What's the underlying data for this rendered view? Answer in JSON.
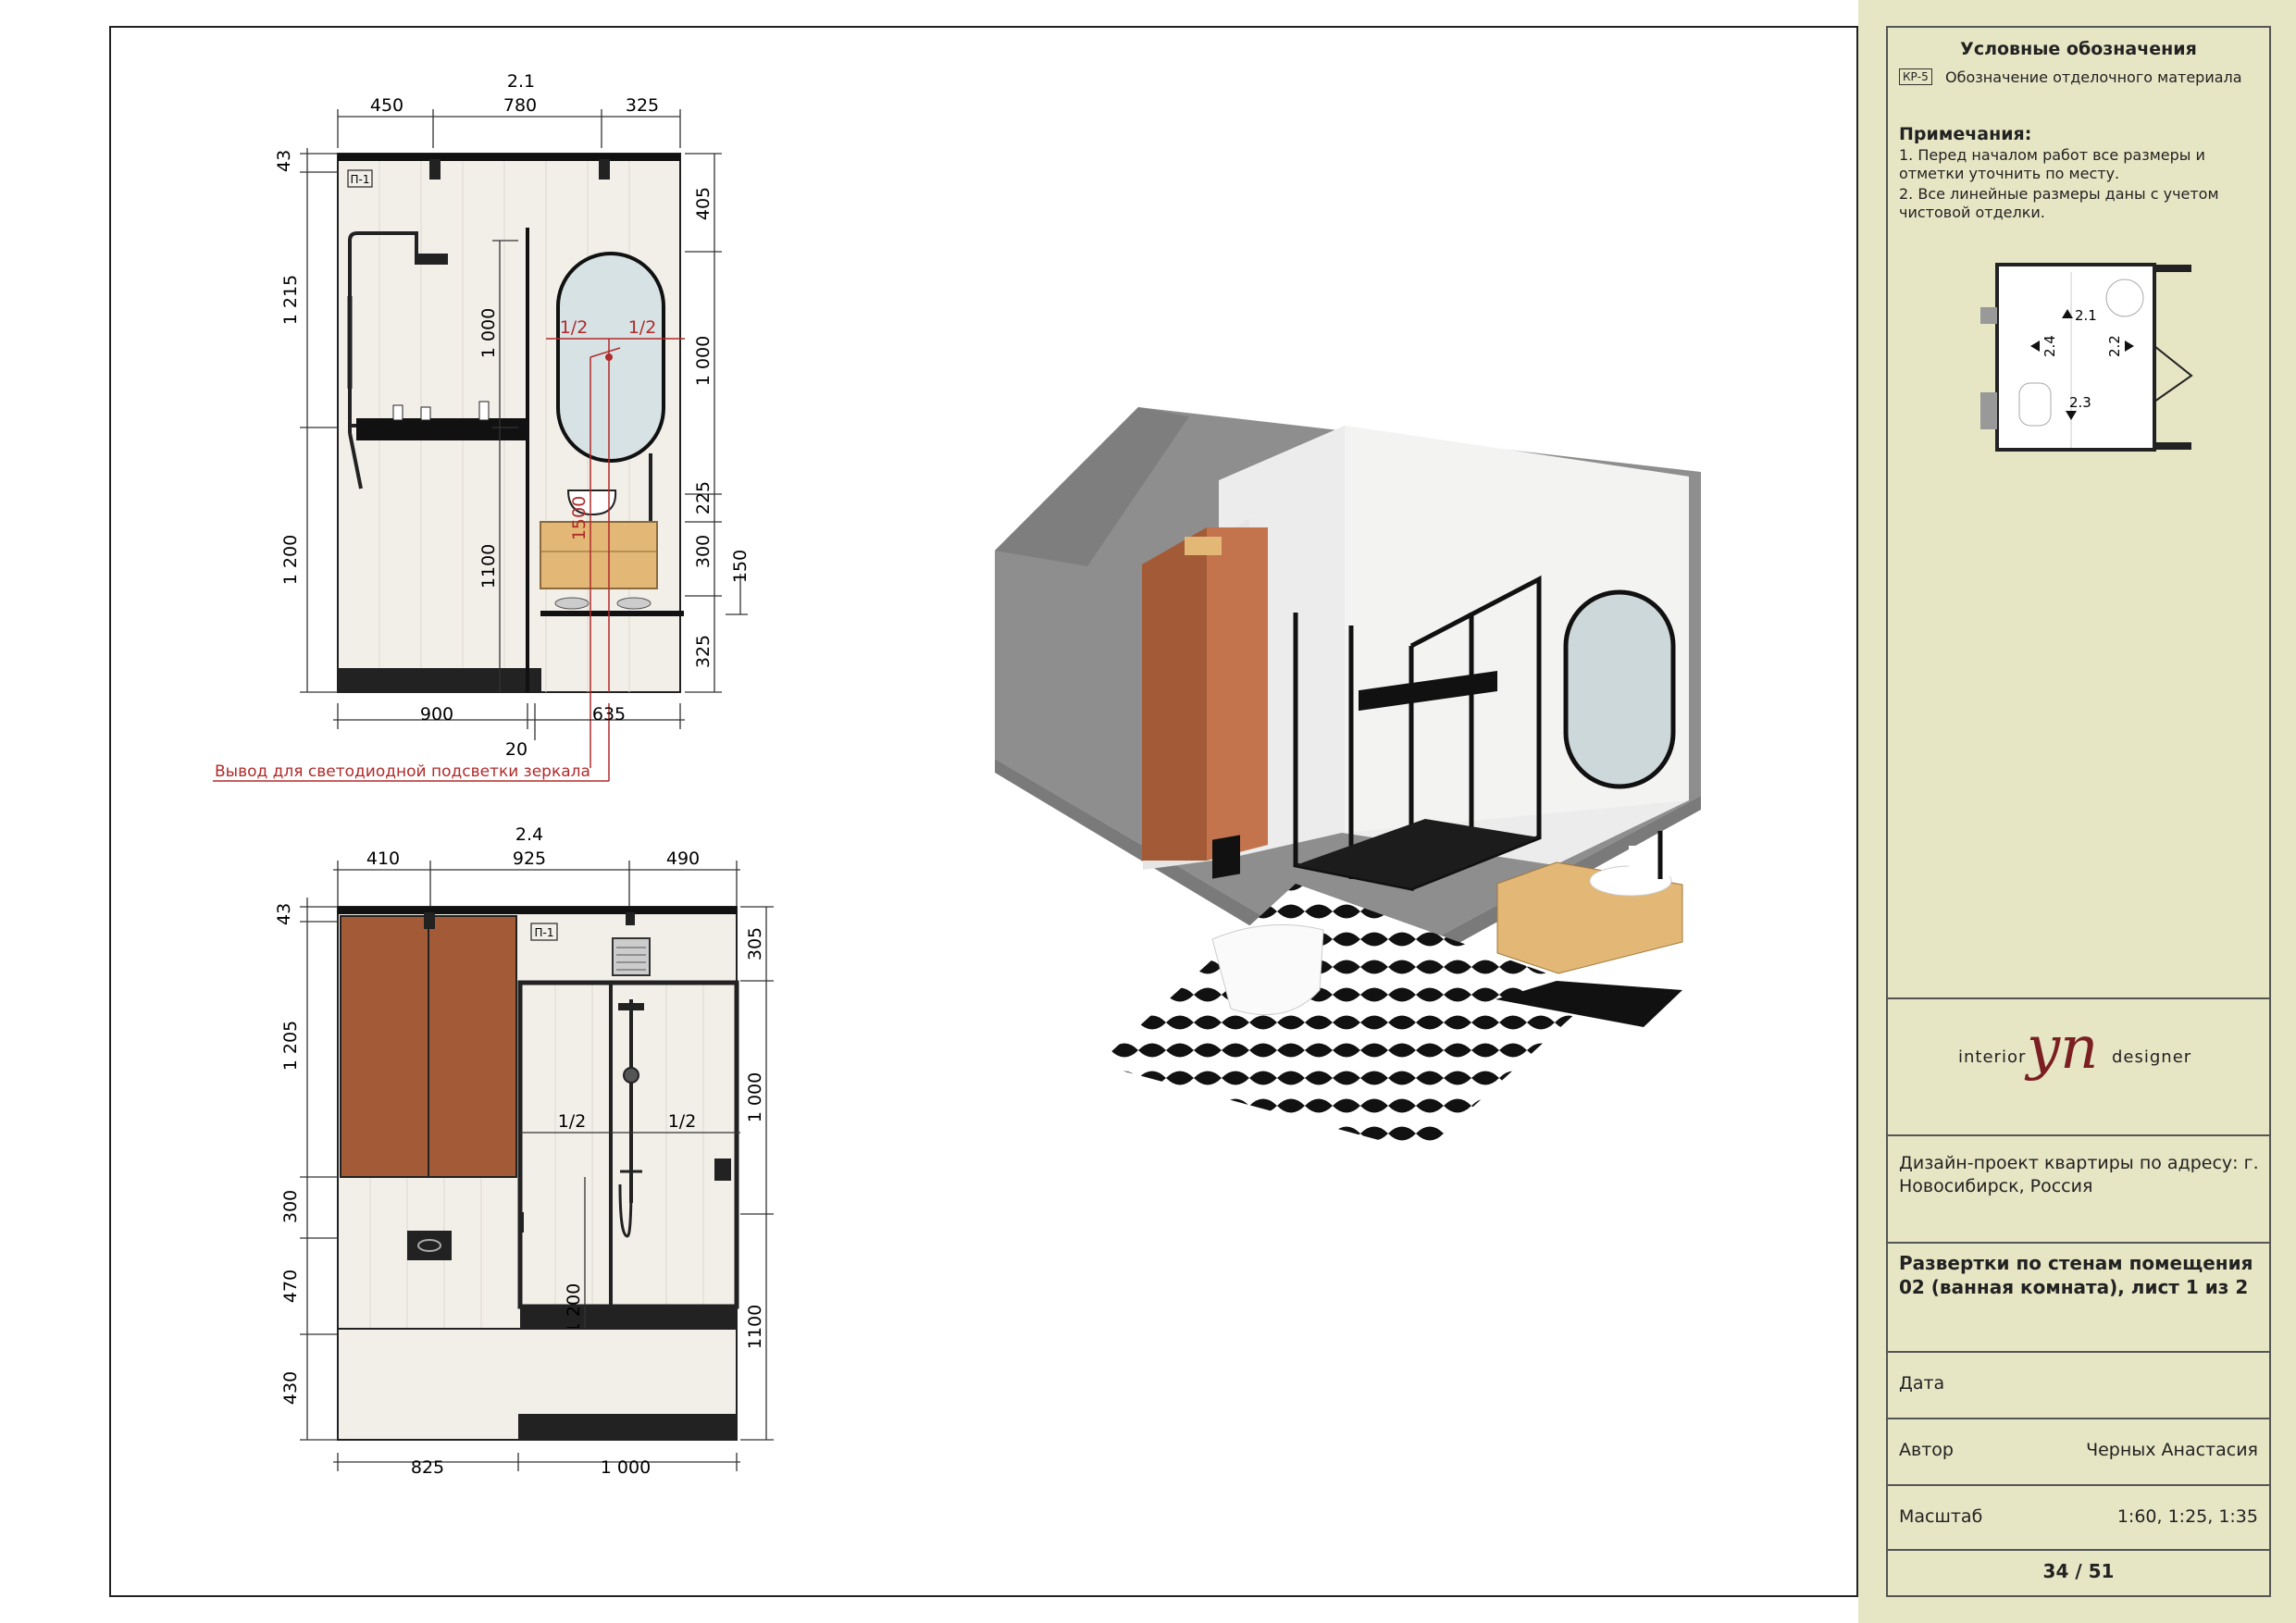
{
  "elevation_21": {
    "title": "2.1",
    "top_dims": [
      "450",
      "780",
      "325"
    ],
    "left_dims": [
      "43",
      "1 215",
      "1 200"
    ],
    "inner_dims": [
      "1 000",
      "1100",
      "1500"
    ],
    "right_dims": [
      "405",
      "1 000",
      "225",
      "300",
      "325",
      "150"
    ],
    "bottom_dims": [
      "900",
      "635",
      "20"
    ],
    "halves": [
      "1/2",
      "1/2"
    ],
    "material_tag": "П-1",
    "led_note": "Вывод для светодиодной подсветки зеркала"
  },
  "elevation_24": {
    "title": "2.4",
    "top_dims": [
      "410",
      "925",
      "490"
    ],
    "left_dims": [
      "43",
      "1 205",
      "300",
      "470",
      "430"
    ],
    "inner_dims": [
      "1 200"
    ],
    "right_dims": [
      "305",
      "1 000",
      "1100"
    ],
    "bottom_dims": [
      "825",
      "1 000"
    ],
    "halves": [
      "1/2",
      "1/2"
    ],
    "material_tag": "П-1"
  },
  "legend": {
    "title": "Условные обозначения",
    "code": "КР-5",
    "text": "Обозначение отделочного материала"
  },
  "notes": {
    "title": "Примечания:",
    "items": [
      "1. Перед началом работ все размеры и отметки уточнить по месту.",
      "2. Все линейные размеры даны с учетом чистовой отделки."
    ]
  },
  "keyplan": {
    "labels": [
      "2.1",
      "2.4",
      "2.2",
      "2.3"
    ]
  },
  "logo": {
    "left": "interior",
    "mark": "yn",
    "right": "designer"
  },
  "project": "Дизайн-проект квартиры по адресу: г. Новосибирск, Россия",
  "sheet_title": "Развертки по стенам помещения 02 (ванная комната), лист 1 из 2",
  "fields": {
    "date_label": "Дата",
    "date_value": "",
    "author_label": "Автор",
    "author_value": "Черных Анастасия",
    "scale_label": "Масштаб",
    "scale_value": "1:60, 1:25, 1:35"
  },
  "page": "34 / 51",
  "colors": {
    "panel_bg": "#e6e5c4",
    "accent_red": "#b02a2a",
    "cabinet_brown": "#a35a36",
    "cabinet_orange": "#c4744c",
    "wood": "#e3b775",
    "tile": "#f2efe9"
  }
}
